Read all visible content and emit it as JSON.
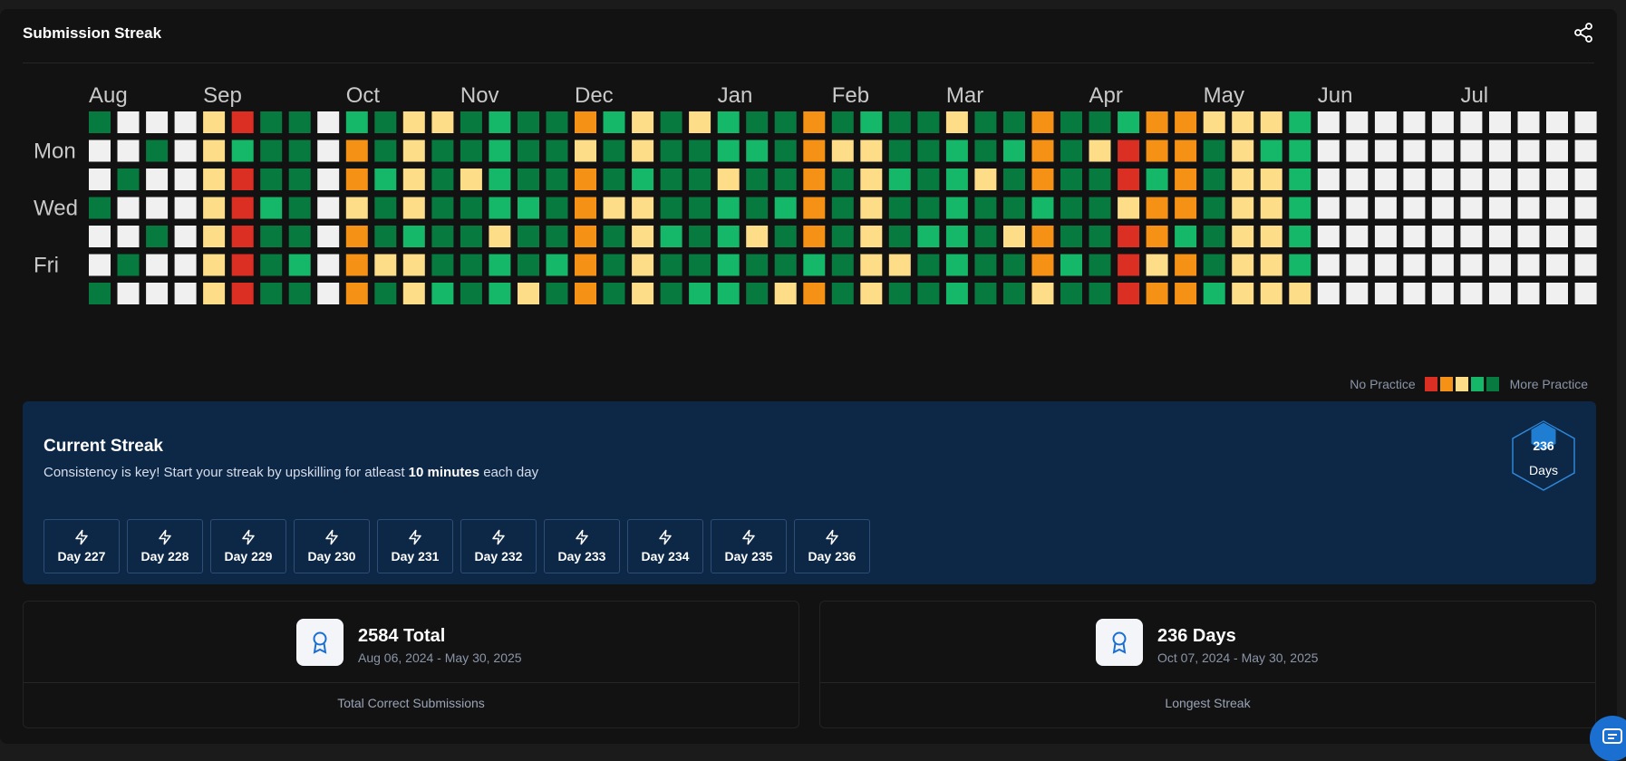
{
  "header": {
    "title": "Submission Streak",
    "share_icon": "share-icon"
  },
  "heatmap": {
    "months": [
      "Aug",
      "Sep",
      "Oct",
      "Nov",
      "Dec",
      "Jan",
      "Feb",
      "Mar",
      "Apr",
      "May",
      "Jun",
      "Jul"
    ],
    "weekday_labels": [
      "Mon",
      "Wed",
      "Fri"
    ],
    "colors": {
      "none": "#f0f0f0",
      "level1": "#dc2f23",
      "level2": "#f59215",
      "level3": "#fedd89",
      "level4": "#14b868",
      "level5": "#077a40"
    },
    "legend": {
      "left": "No Practice",
      "right": "More Practice"
    }
  },
  "current_streak": {
    "title": "Current Streak",
    "subtitle_prefix": "Consistency is key! Start your streak by upskilling for atleast ",
    "subtitle_bold": "10 minutes",
    "subtitle_suffix": " each day",
    "days": [
      "Day 227",
      "Day 228",
      "Day 229",
      "Day 230",
      "Day 231",
      "Day 232",
      "Day 233",
      "Day 234",
      "Day 235",
      "Day 236"
    ],
    "badge_value": "236",
    "badge_label": "Days"
  },
  "stats": {
    "total": {
      "value": "2584 Total",
      "range": "Aug 06, 2024 - May 30, 2025",
      "label": "Total Correct Submissions"
    },
    "longest": {
      "value": "236 Days",
      "range": "Oct 07, 2024 - May 30, 2025",
      "label": "Longest Streak"
    }
  },
  "chat": {
    "icon": "chat-icon"
  }
}
